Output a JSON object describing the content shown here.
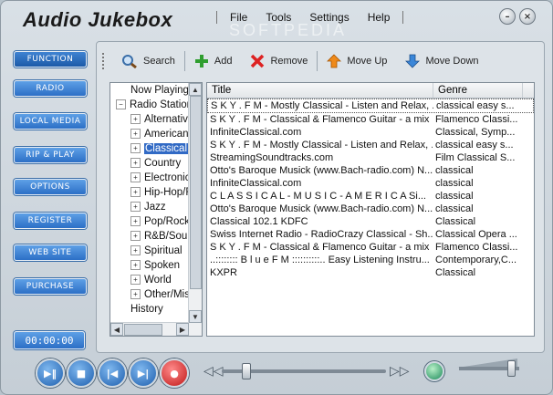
{
  "app": {
    "title": "Audio Jukebox",
    "watermark": "SOFTPEDIA"
  },
  "menu": [
    "File",
    "Tools",
    "Settings",
    "Help"
  ],
  "window_buttons": {
    "minimize": "–",
    "close": "×"
  },
  "sidebar": {
    "items": [
      {
        "label": "FUNCTION",
        "active": true
      },
      {
        "label": "RADIO"
      },
      {
        "label": "LOCAL MEDIA"
      },
      {
        "label": "RIP & PLAY"
      },
      {
        "label": "OPTIONS"
      },
      {
        "label": "REGISTER"
      },
      {
        "label": "WEB SITE"
      },
      {
        "label": "PURCHASE"
      }
    ],
    "timer": "00:00:00"
  },
  "toolbar": {
    "search": "Search",
    "add": "Add",
    "remove": "Remove",
    "move_up": "Move Up",
    "move_down": "Move Down"
  },
  "tree": {
    "root_now_playing": "Now Playing",
    "root_radio": "Radio Stations",
    "children": [
      "Alternative",
      "American",
      "Classical",
      "Country",
      "Electronic",
      "Hip-Hop/Rap",
      "Jazz",
      "Pop/Rock",
      "R&B/Soul",
      "Spiritual",
      "Spoken",
      "World",
      "Other/Misc"
    ],
    "selected": "Classical",
    "history": "History"
  },
  "list": {
    "columns": [
      "Title",
      "Genre"
    ],
    "rows": [
      {
        "title": "S K Y . F M - Mostly Classical - Listen and Relax, ...",
        "genre": "classical easy s..."
      },
      {
        "title": "S K Y . F M - Classical & Flamenco Guitar - a mix ...",
        "genre": "Flamenco Classi..."
      },
      {
        "title": "InfiniteClassical.com",
        "genre": "Classical, Symp..."
      },
      {
        "title": "S K Y . F M - Mostly Classical - Listen and Relax, ...",
        "genre": "classical easy s..."
      },
      {
        "title": "StreamingSoundtracks.com",
        "genre": "Film Classical S..."
      },
      {
        "title": "Otto's Baroque Musick (www.Bach-radio.com)  N...",
        "genre": "classical"
      },
      {
        "title": "InfiniteClassical.com",
        "genre": "classical"
      },
      {
        "title": "C L A S S I C A L - M U S I C - A M E R I C A  Si...",
        "genre": "classical"
      },
      {
        "title": "Otto's Baroque Musick (www.Bach-radio.com)  N...",
        "genre": "classical"
      },
      {
        "title": "Classical 102.1 KDFC",
        "genre": "Classical"
      },
      {
        "title": "Swiss Internet Radio - RadioCrazy Classical - Sh...",
        "genre": "Classical Opera ..."
      },
      {
        "title": "S K Y . F M - Classical & Flamenco Guitar - a mix ...",
        "genre": "Flamenco Classi..."
      },
      {
        "title": "..:::::::: B l u e F M ::::::::::..  Easy Listening Instru...",
        "genre": "Contemporary,C..."
      },
      {
        "title": "KXPR",
        "genre": "Classical"
      }
    ]
  },
  "player": {
    "seek_position": 0.13,
    "volume": 0.9
  }
}
